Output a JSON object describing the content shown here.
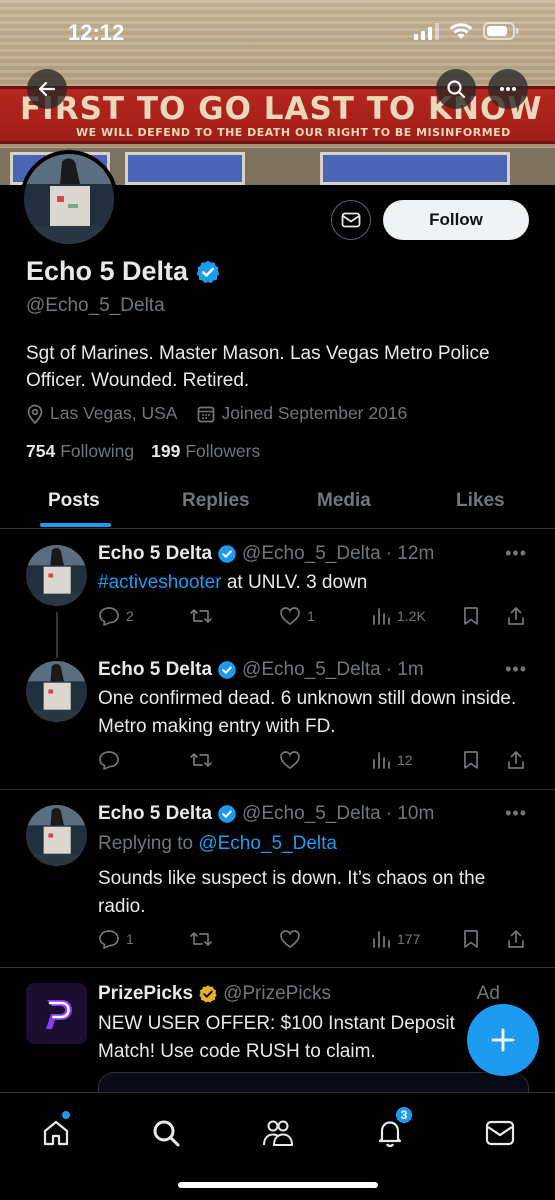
{
  "status_bar": {
    "time": "12:12"
  },
  "banner": {
    "sign_text": "FIRST TO GO  LAST TO KNOW",
    "sign_subtext": "WE WILL DEFEND TO THE DEATH OUR RIGHT TO BE MISINFORMED"
  },
  "profile": {
    "display_name": "Echo 5 Delta",
    "handle": "@Echo_5_Delta",
    "bio": "Sgt of Marines. Master Mason. Las Vegas Metro Police Officer. Wounded. Retired.",
    "location": "Las Vegas, USA",
    "joined": "Joined September 2016",
    "following_count": "754",
    "following_label": "Following",
    "followers_count": "199",
    "followers_label": "Followers",
    "follow_button": "Follow"
  },
  "tabs": [
    "Posts",
    "Replies",
    "Media",
    "Likes"
  ],
  "tweets": [
    {
      "name": "Echo 5 Delta",
      "handle": "@Echo_5_Delta",
      "time": "· 12m",
      "hashtag": "#activeshooter",
      "text": " at UNLV. 3 down",
      "replies": "2",
      "retweets": "",
      "likes": "1",
      "views": "1.2K"
    },
    {
      "name": "Echo 5 Delta",
      "handle": "@Echo_5_Delta",
      "time": "· 1m",
      "text": "One confirmed dead. 6 unknown still down inside. Metro making entry with FD.",
      "replies": "",
      "retweets": "",
      "likes": "",
      "views": "12"
    },
    {
      "name": "Echo 5 Delta",
      "handle": "@Echo_5_Delta",
      "time": "· 10m",
      "replying_prefix": "Replying to ",
      "replying_to": "@Echo_5_Delta",
      "text": "Sounds like suspect is down. It’s chaos on the radio.",
      "replies": "1",
      "retweets": "",
      "likes": "",
      "views": "177"
    }
  ],
  "ad": {
    "name": "PrizePicks",
    "handle": "@PrizePicks",
    "label": "Ad",
    "text": "NEW USER OFFER: $100 Instant Deposit Match! Use code RUSH to claim."
  },
  "nav": {
    "notifications_badge": "3"
  },
  "colors": {
    "accent": "#1d9bf0",
    "background": "#000000",
    "verified_gold": "#e8b02a"
  }
}
